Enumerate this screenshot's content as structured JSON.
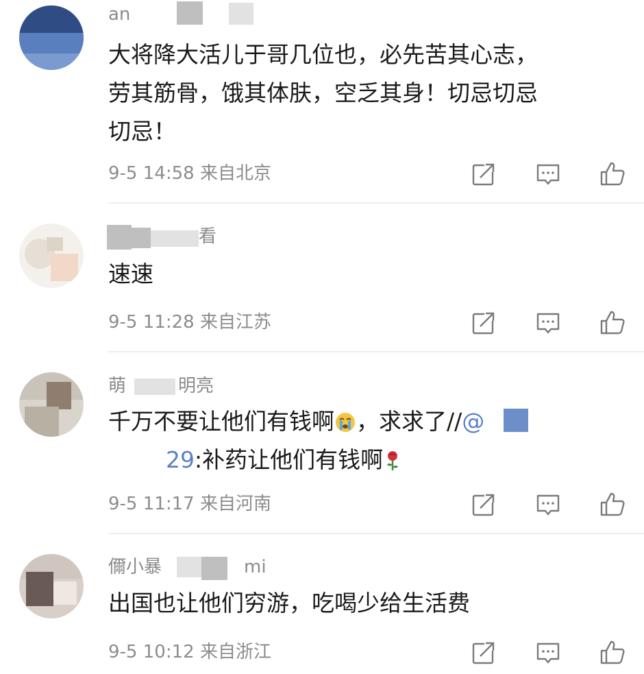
{
  "comments": [
    {
      "username": "an",
      "text_lines": [
        "大将降大活儿于哥几位也，必先苦其心志，",
        "劳其筋骨，饿其体肤，空乏其身！切忌切忌",
        "切忌！"
      ],
      "date": "9-5 14:58",
      "location": "来自北京"
    },
    {
      "username": "看",
      "text_lines": [
        "速速"
      ],
      "date": "9-5 11:28",
      "location": "来自江苏"
    },
    {
      "username": "萌",
      "username_tail": "明亮",
      "text_line1": "千万不要让他们有钱啊",
      "text_line1_tail": "，求求了//",
      "mention_at": "@",
      "mention_num": "29",
      "text_line2": ":补药让他们有钱啊",
      "date": "9-5 11:17",
      "location": "来自河南"
    },
    {
      "username": "儞小暴",
      "username_tail": "mi",
      "text_lines": [
        "出国也让他们穷游，吃喝少给生活费"
      ],
      "date": "9-5 10:12",
      "location": "来自浙江"
    }
  ],
  "icons": {
    "share": "share-icon",
    "reply": "comment-icon",
    "like": "thumbs-up-icon"
  },
  "colors": {
    "mention": "#5a82c7",
    "meta": "#8c8c8c",
    "text": "#1a1a1a"
  }
}
